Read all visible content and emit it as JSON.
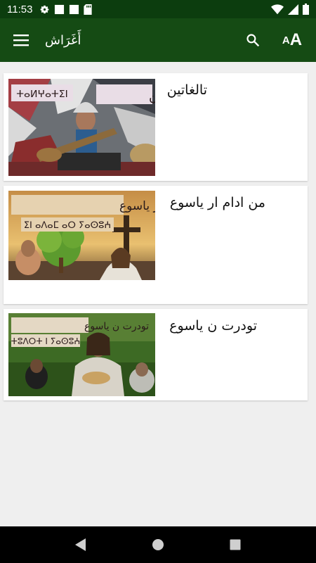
{
  "status_bar": {
    "time": "11:53"
  },
  "app_bar": {
    "title": "أَغَرَاش",
    "menu_icon": "menu-icon",
    "search_icon": "search-icon",
    "text_size_small": "A",
    "text_size_large": "A"
  },
  "items": [
    {
      "title": "تالغاتين",
      "thumb_caption": "تالغاتين",
      "thumb_tifinagh": "ⵜⴰⵍⵖⴰⵜⵉⵏ"
    },
    {
      "title": "من ادام ار ياسوع",
      "thumb_caption": "من ادام ار ياسوع",
      "thumb_tifinagh": "ⵉⵏ ⴰⴷⴰⵎ ⴰⵔ ⵢⴰⵙⵓⵄ"
    },
    {
      "title": "تودرت ن ياسوع",
      "thumb_caption": "تودرت ن ياسوع",
      "thumb_tifinagh": "ⵜⵓⴷⵔⵜ ⵏ ⵢⴰⵙⵓⵄ"
    }
  ],
  "colors": {
    "status_bar": "#0c3d0e",
    "app_bar": "#154b14",
    "background": "#efefef"
  }
}
